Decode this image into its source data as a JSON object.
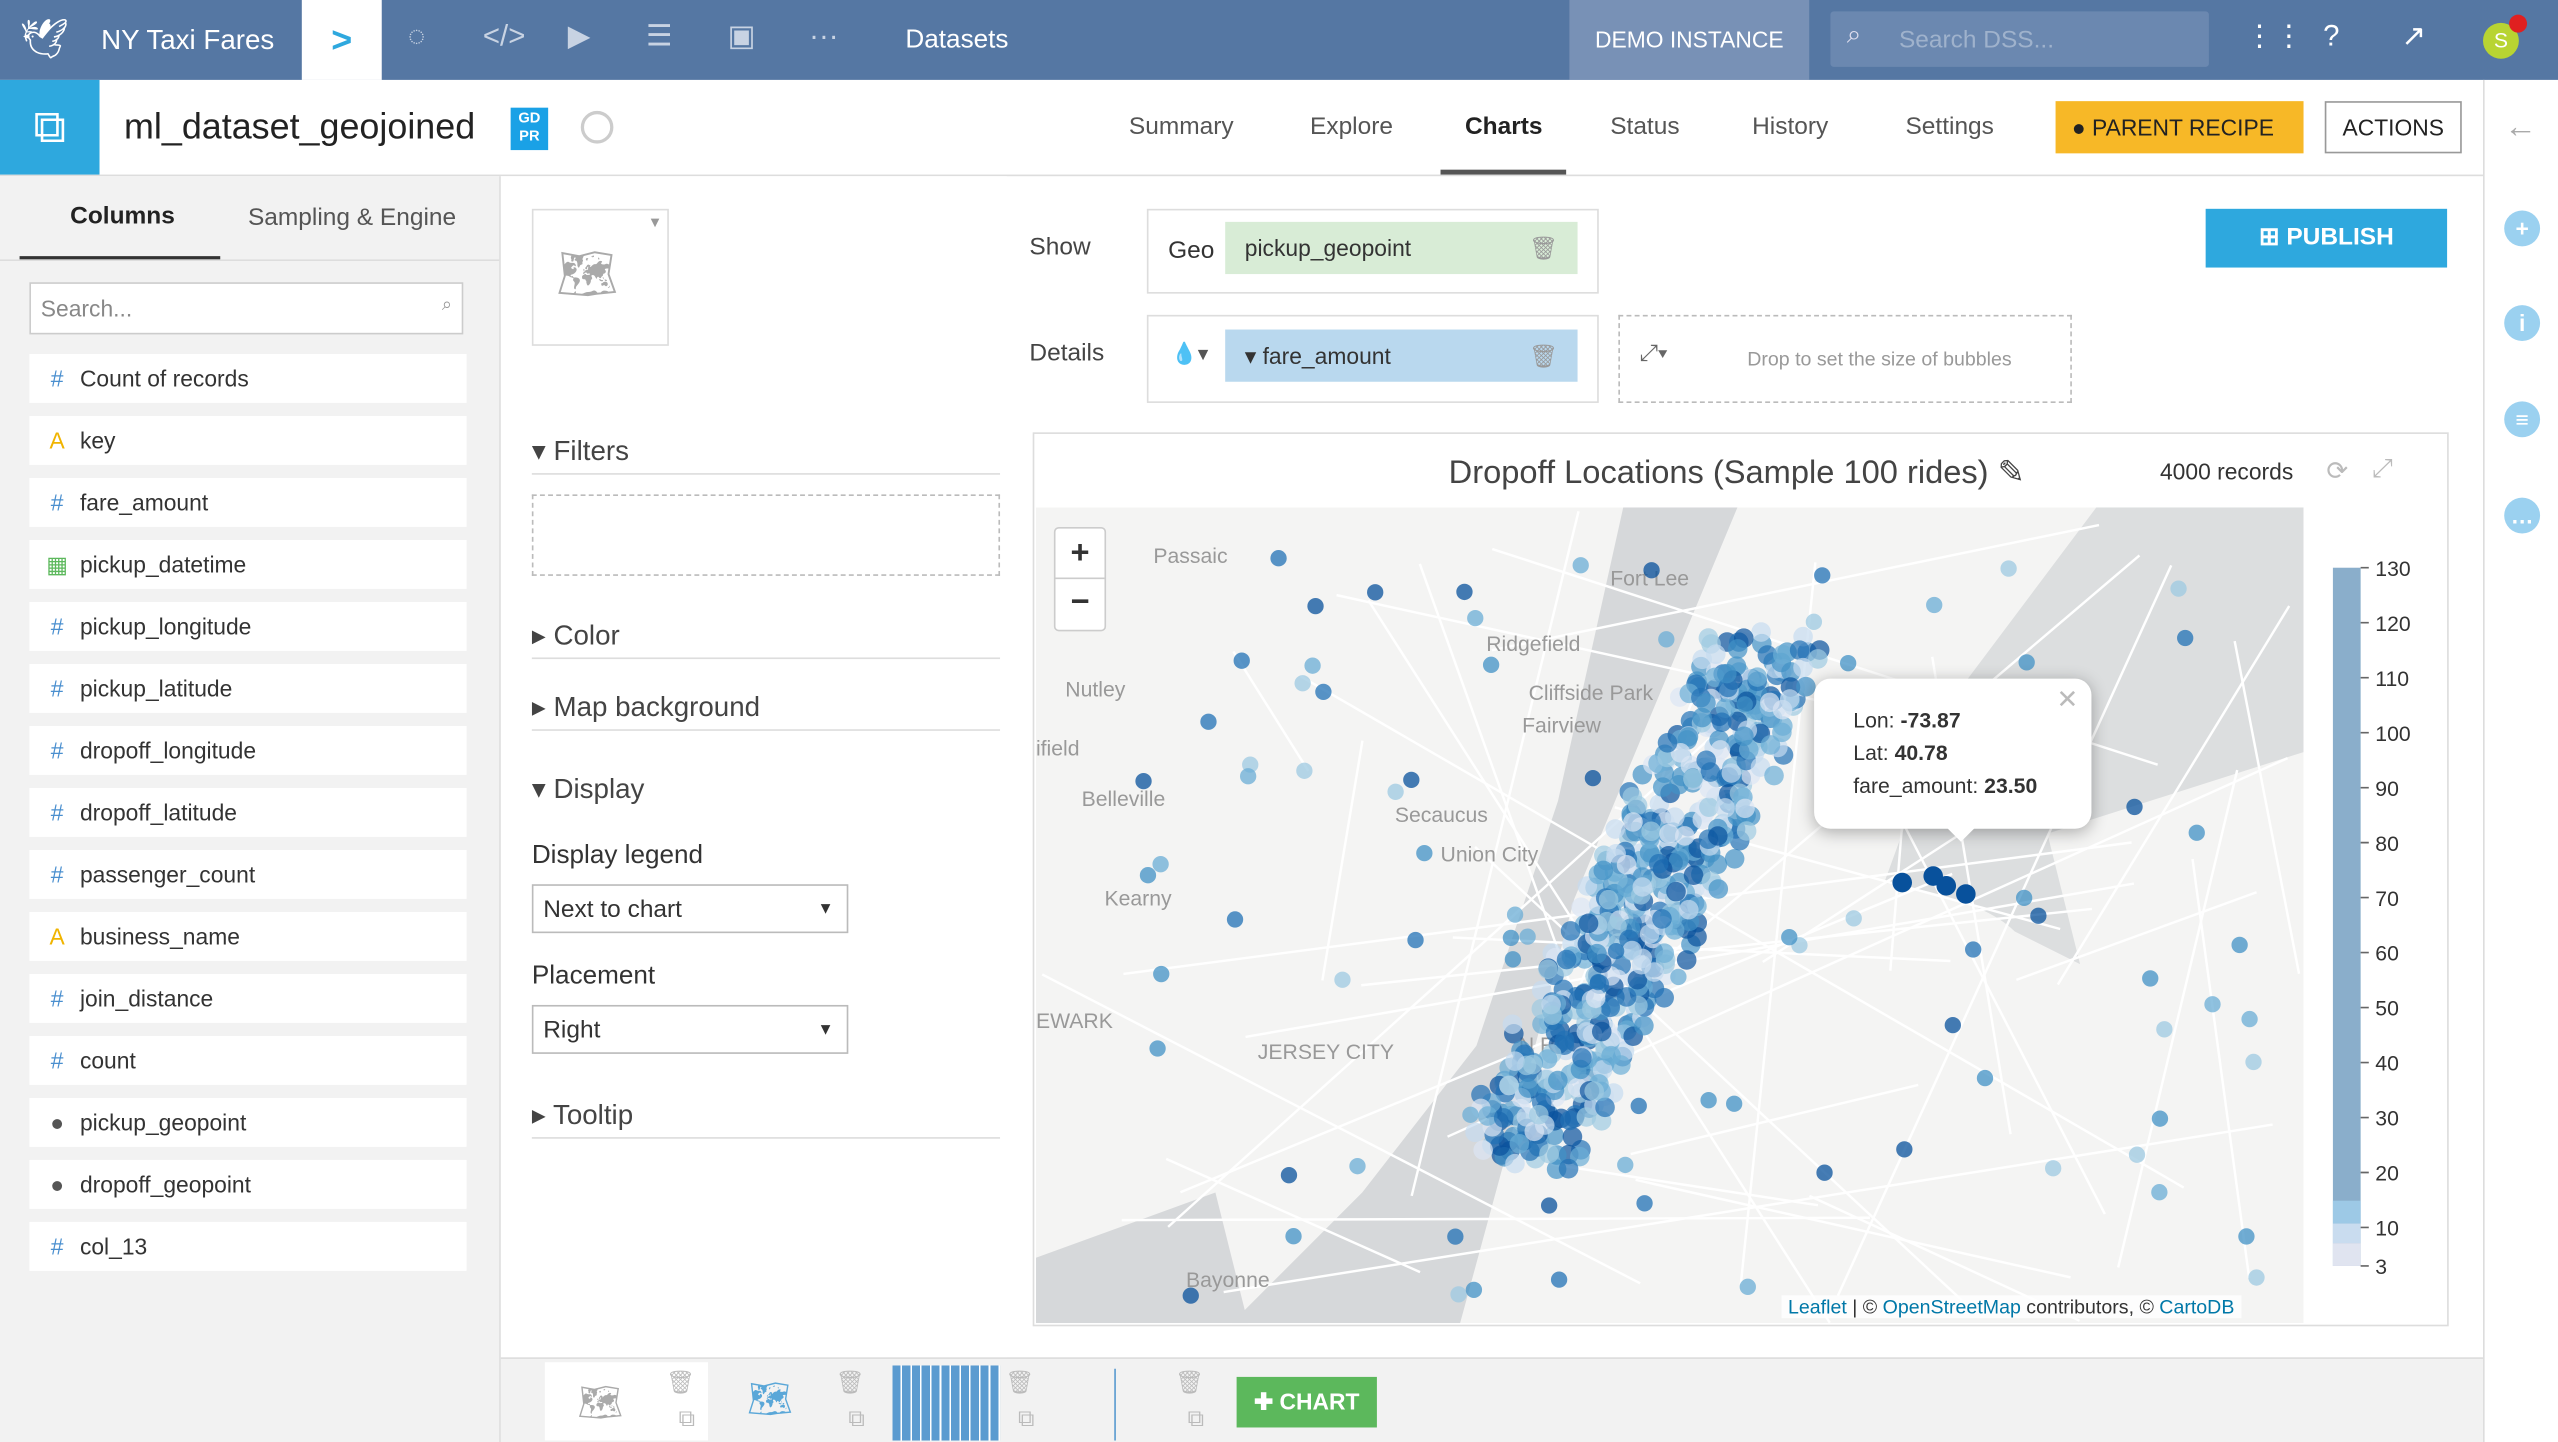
{
  "topbar": {
    "project": "NY Taxi Fares",
    "section": "Datasets",
    "instance": "DEMO INSTANCE",
    "search_placeholder": "Search DSS...",
    "avatar": "S"
  },
  "dataset": {
    "name": "ml_dataset_geojoined",
    "badge": "GD PR"
  },
  "tabs": [
    "Summary",
    "Explore",
    "Charts",
    "Status",
    "History",
    "Settings"
  ],
  "active_tab": "Charts",
  "buttons": {
    "parent_recipe": "PARENT RECIPE",
    "actions": "ACTIONS",
    "publish": "PUBLISH",
    "chart": "CHART"
  },
  "left_tabs": [
    "Columns",
    "Sampling & Engine"
  ],
  "column_search_placeholder": "Search...",
  "columns": [
    {
      "type": "#",
      "name": "Count of records"
    },
    {
      "type": "A",
      "name": "key"
    },
    {
      "type": "#",
      "name": "fare_amount"
    },
    {
      "type": "date",
      "name": "pickup_datetime"
    },
    {
      "type": "#",
      "name": "pickup_longitude"
    },
    {
      "type": "#",
      "name": "pickup_latitude"
    },
    {
      "type": "#",
      "name": "dropoff_longitude"
    },
    {
      "type": "#",
      "name": "dropoff_latitude"
    },
    {
      "type": "#",
      "name": "passenger_count"
    },
    {
      "type": "A",
      "name": "business_name"
    },
    {
      "type": "#",
      "name": "join_distance"
    },
    {
      "type": "#",
      "name": "count"
    },
    {
      "type": "geo",
      "name": "pickup_geopoint"
    },
    {
      "type": "geo",
      "name": "dropoff_geopoint"
    },
    {
      "type": "#",
      "name": "col_13"
    }
  ],
  "config": {
    "show_label": "Show",
    "geo_label": "Geo",
    "geo_field": "pickup_geopoint",
    "details_label": "Details",
    "color_field": "fare_amount",
    "size_drop": "Drop to set the size of bubbles"
  },
  "panel": {
    "filters": "Filters",
    "color": "Color",
    "map_background": "Map background",
    "display": "Display",
    "display_legend_label": "Display legend",
    "display_legend_value": "Next to chart",
    "placement_label": "Placement",
    "placement_value": "Right",
    "tooltip": "Tooltip"
  },
  "chart": {
    "title": "Dropoff Locations (Sample 100 rides)",
    "records": "4000 records",
    "map_labels": [
      "Passaic",
      "Fort Lee",
      "Ridgefield",
      "Nutley",
      "Cliffside Park",
      "Fairview",
      "ifield",
      "Belleville",
      "Secaucus",
      "Union City",
      "Kearny",
      "EWARK",
      "JERSEY CITY",
      "N    RK",
      "Bayonne"
    ],
    "tooltip": {
      "lon_label": "Lon:",
      "lon": "-73.87",
      "lat_label": "Lat:",
      "lat": "40.78",
      "fa_label": "fare_amount:",
      "fa": "23.50"
    },
    "legend_ticks": [
      "130",
      "120",
      "110",
      "100",
      "90",
      "80",
      "70",
      "60",
      "50",
      "40",
      "30",
      "20",
      "10",
      "3"
    ],
    "attribution": {
      "leaflet": "Leaflet",
      "sep": " | © ",
      "osm": "OpenStreetMap",
      "mid": " contributors, © ",
      "carto": "CartoDB"
    },
    "zoom_in": "+",
    "zoom_out": "−",
    "accent": "#2a7ab8"
  }
}
